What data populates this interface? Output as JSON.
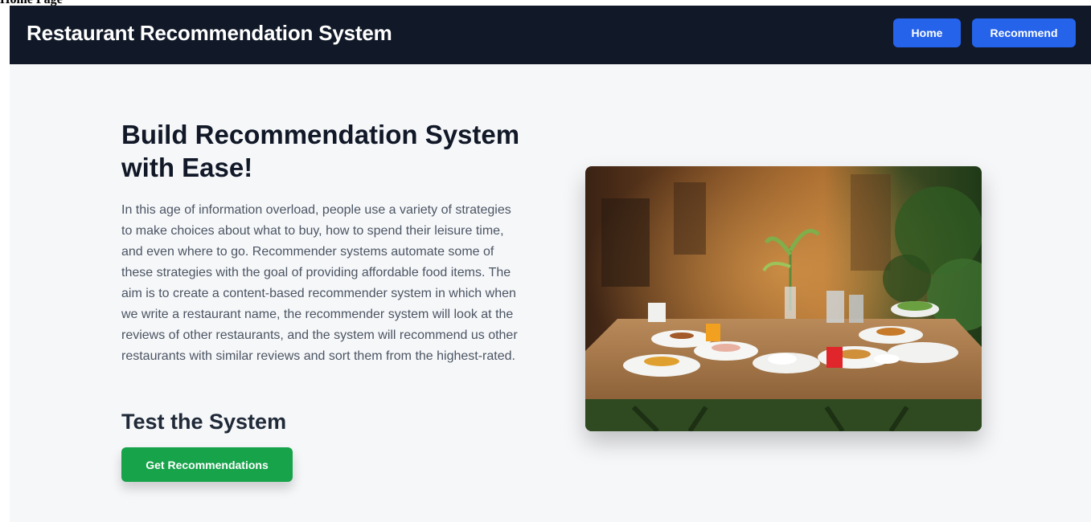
{
  "page_label": "Home Page",
  "navbar": {
    "brand": "Restaurant Recommendation System",
    "home_label": "Home",
    "recommend_label": "Recommend"
  },
  "hero": {
    "headline": "Build Recommendation System with Ease!",
    "paragraph": "In this age of information overload, people use a variety of strategies to make choices about what to buy, how to spend their leisure time, and even where to go. Recommender systems automate some of these strategies with the goal of providing affordable food items. The aim is to create a content-based recommender system in which when we write a restaurant name, the recommender system will look at the reviews of other restaurants, and the system will recommend us other restaurants with similar reviews and sort them from the highest-rated.",
    "subheading": "Test the System",
    "cta_label": "Get Recommendations"
  },
  "image": {
    "icon": "restaurant-table-photo"
  },
  "colors": {
    "navbar_bg": "#111827",
    "nav_button": "#2563eb",
    "cta_button": "#16a34a",
    "page_bg": "#f6f7f9"
  }
}
